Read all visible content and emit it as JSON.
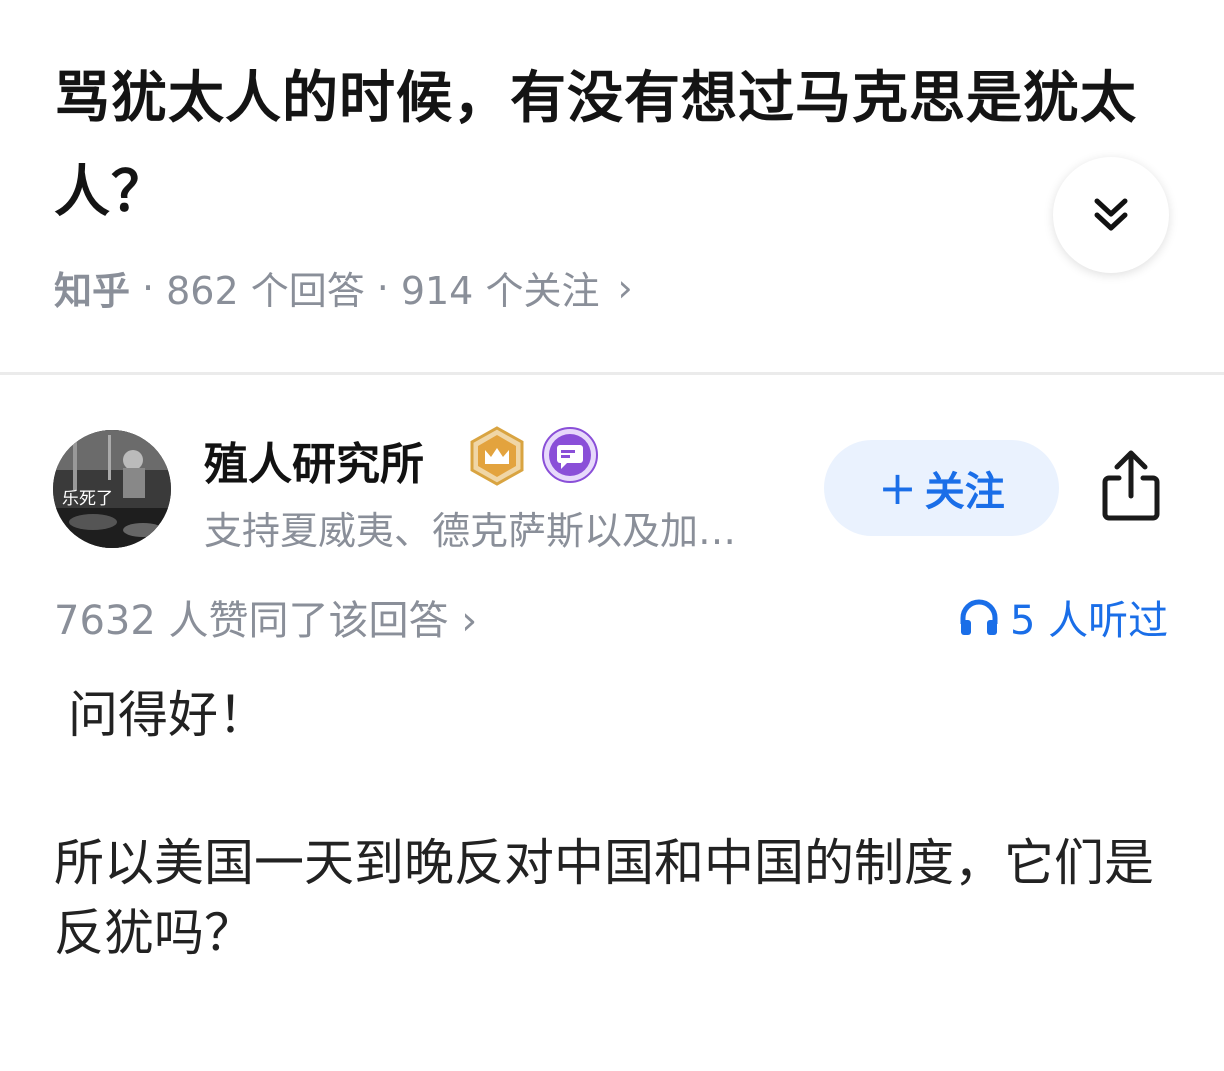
{
  "question": {
    "title": "骂犹太人的时候，有没有想过马克思是犹太人？",
    "source": "知乎",
    "answers_count": "862 个回答",
    "followers_count": "914 个关注",
    "separator": "·"
  },
  "author": {
    "name": "殖人研究所",
    "bio": "支持夏威夷、德克萨斯以及加…",
    "avatar_text": "乐死了",
    "follow_label": "关注"
  },
  "answer": {
    "approval": "7632 人赞同了该回答",
    "listened": "5 人听过",
    "paragraphs": [
      "问得好！",
      "所以美国一天到晚反对中国和中国的制度，它们是反犹吗？"
    ]
  },
  "icons": {
    "collapse": "double-chevron-down-icon",
    "crown_badge": "crown-badge-icon",
    "chat_badge": "chat-badge-icon",
    "share": "share-icon",
    "headphones": "headphones-icon"
  },
  "colors": {
    "accent": "#1a6ee8",
    "follow_bg": "#eaf2fe",
    "muted": "#8a8f99",
    "crown_gold": "#d9a441",
    "chat_purple": "#8a4fd8"
  }
}
